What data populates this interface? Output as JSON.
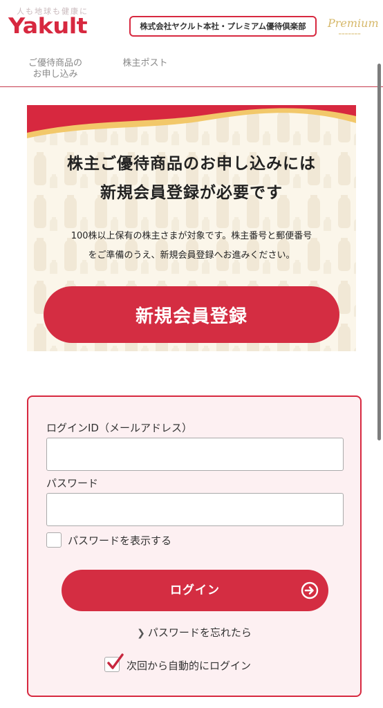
{
  "header": {
    "tagline": "人も地球も健康に",
    "logo": "Yakult",
    "club_name": "株式会社ヤクルト本社・プレミアム優待倶楽部",
    "premium_logo": "Premium"
  },
  "nav": {
    "items": [
      {
        "label_line1": "ご優待商品の",
        "label_line2": "お申し込み"
      },
      {
        "label": "株主ポスト"
      }
    ]
  },
  "banner": {
    "title_line1": "株主ご優待商品のお申し込みには",
    "title_line2": "新規会員登録が必要です",
    "desc_line1": "100株以上保有の株主さまが対象です。株主番号と郵便番号",
    "desc_line2": "をご準備のうえ、新規会員登録へお進みください。",
    "register_button": "新規会員登録",
    "colors": {
      "wave_red": "#d7283f",
      "wave_gold": "#f2c86a",
      "background": "#fbf6ea"
    }
  },
  "login": {
    "id_label": "ログインID（メールアドレス）",
    "id_value": "",
    "password_label": "パスワード",
    "password_value": "",
    "show_password_label": "パスワードを表示する",
    "show_password_checked": false,
    "login_button": "ログイン",
    "forgot_link": "パスワードを忘れたら",
    "auto_login_label": "次回から自動的にログイン",
    "auto_login_checked": true
  },
  "colors": {
    "accent": "#d42d42",
    "card_bg": "#fdf0f2"
  },
  "icons": {
    "login_arrow": "arrow-circle-right-icon",
    "forgot_chevron": "chevron-right-icon",
    "auto_login_check": "checkmark-icon"
  }
}
